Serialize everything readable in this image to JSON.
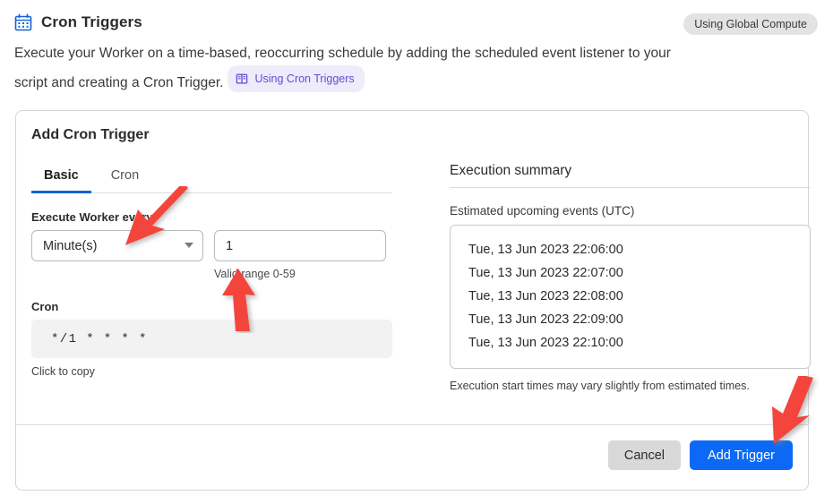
{
  "header": {
    "icon": "calendar-icon",
    "title": "Cron Triggers",
    "description_part1": "Execute your Worker on a time-based, reoccurring schedule by adding the scheduled event listener to your script and creating a Cron Trigger.",
    "doc_badge": {
      "icon": "book-icon",
      "label": "Using Cron Triggers"
    },
    "compute_badge": "Using Global Compute"
  },
  "card": {
    "title": "Add Cron Trigger",
    "tabs": [
      {
        "label": "Basic",
        "active": true
      },
      {
        "label": "Cron",
        "active": false
      }
    ],
    "schedule": {
      "label": "Execute Worker every",
      "unit_select": {
        "value": "Minute(s)",
        "icon": "chevron-down-icon"
      },
      "amount_input": {
        "value": "1",
        "placeholder": ""
      },
      "hint": "Valid range 0-59"
    },
    "cron": {
      "label": "Cron",
      "expression": "*/1 * * * *",
      "copy_hint": "Click to copy"
    },
    "summary": {
      "title": "Execution summary",
      "events_label": "Estimated upcoming events (UTC)",
      "events": [
        "Tue, 13 Jun 2023 22:06:00",
        "Tue, 13 Jun 2023 22:07:00",
        "Tue, 13 Jun 2023 22:08:00",
        "Tue, 13 Jun 2023 22:09:00",
        "Tue, 13 Jun 2023 22:10:00"
      ],
      "note": "Execution start times may vary slightly from estimated times."
    },
    "footer": {
      "cancel_label": "Cancel",
      "submit_label": "Add Trigger"
    }
  },
  "annotations": {
    "arrow_color": "#f4443c",
    "arrows": [
      {
        "name": "arrow-to-unit-select",
        "direction": "down-left"
      },
      {
        "name": "arrow-to-valid-range",
        "direction": "up"
      },
      {
        "name": "arrow-to-add-trigger",
        "direction": "down-left"
      }
    ]
  },
  "colors": {
    "accent_blue": "#0b69f5",
    "tab_underline": "#1463d4",
    "doc_badge_bg": "#eeecfb",
    "doc_badge_text": "#5b4fcf",
    "compute_badge_bg": "#e3e3e3",
    "cron_box_bg": "#f2f2f2"
  }
}
